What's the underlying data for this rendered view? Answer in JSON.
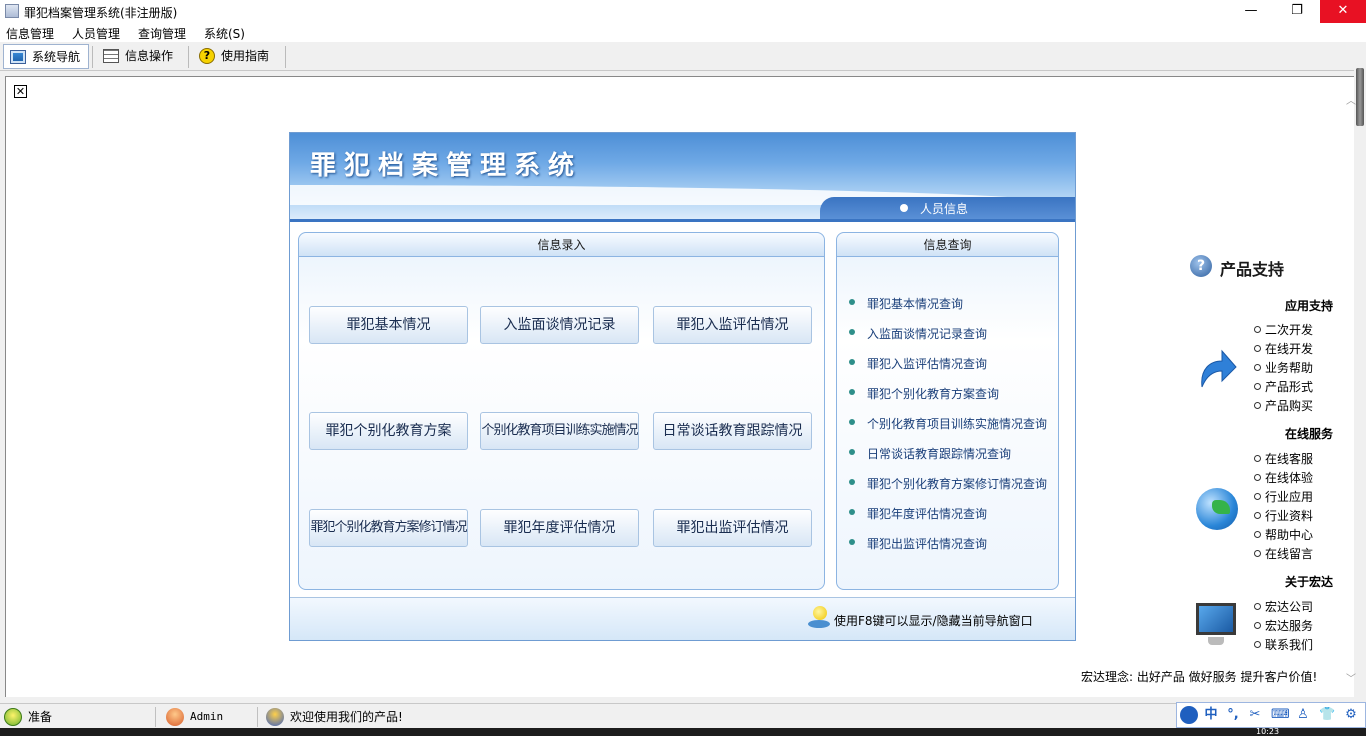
{
  "window": {
    "title": "罪犯档案管理系统(非注册版)",
    "min_glyph": "—",
    "max_glyph": "❐",
    "close_glyph": "✕"
  },
  "menu": [
    "信息管理",
    "人员管理",
    "查询管理",
    "系统(S)"
  ],
  "toolbar": {
    "nav_label": "系统导航",
    "op_label": "信息操作",
    "guide_label": "使用指南"
  },
  "doc_close_glyph": "✕",
  "banner": {
    "title": "罪犯档案管理系统",
    "section_label": "人员信息"
  },
  "entry_box": {
    "title": "信息录入",
    "buttons": [
      "罪犯基本情况",
      "入监面谈情况记录",
      "罪犯入监评估情况",
      "罪犯个别化教育方案",
      "个别化教育项目训练实施情况",
      "日常谈话教育跟踪情况",
      "罪犯个别化教育方案修订情况",
      "罪犯年度评估情况",
      "罪犯出监评估情况"
    ]
  },
  "query_box": {
    "title": "信息查询",
    "links": [
      "罪犯基本情况查询",
      "入监面谈情况记录查询",
      "罪犯入监评估情况查询",
      "罪犯个别化教育方案查询",
      "个别化教育项目训练实施情况查询",
      "日常谈话教育跟踪情况查询",
      "罪犯个别化教育方案修订情况查询",
      "罪犯年度评估情况查询",
      "罪犯出监评估情况查询"
    ]
  },
  "footer_hint": "使用F8键可以显示/隐藏当前导航窗口",
  "support": {
    "title": "产品支持",
    "icon_glyph": "?",
    "sections": [
      {
        "title": "应用支持",
        "links": [
          "二次开发",
          "在线开发",
          "业务帮助",
          "产品形式",
          "产品购买"
        ]
      },
      {
        "title": "在线服务",
        "links": [
          "在线客服",
          "在线体验",
          "行业应用",
          "行业资料",
          "帮助中心",
          "在线留言"
        ]
      },
      {
        "title": "关于宏达",
        "links": [
          "宏达公司",
          "宏达服务",
          "联系我们"
        ]
      }
    ],
    "slogan": "宏达理念: 出好产品  做好服务  提升客户价值!"
  },
  "status": {
    "ready": "准备",
    "user": "Admin",
    "welcome": "欢迎使用我们的产品!"
  },
  "ime_glyphs": [
    "中",
    "°,",
    "✂",
    "⌨",
    "♙",
    "👕",
    "⚙"
  ],
  "taskbar_clock": "10:23",
  "colors": {
    "accent": "#3a74c2",
    "banner_top": "#4e8fd6",
    "link_text": "#1a3f7a",
    "close_red": "#e81123"
  }
}
